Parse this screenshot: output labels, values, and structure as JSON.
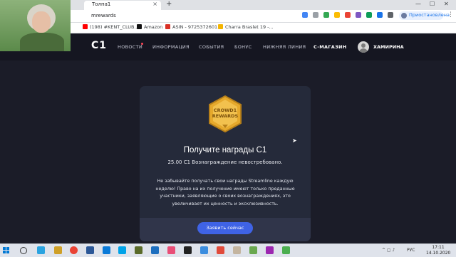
{
  "browser": {
    "tab_title": "Толпа1",
    "tab_close": "×",
    "new_tab": "+",
    "url": "mrewards",
    "profile_label": "Приостановлена",
    "window_controls": [
      "—",
      "☐",
      "✕"
    ],
    "bookmarks": [
      {
        "label": "(198) #KENT_CLUB...",
        "icon": "youtube-icon",
        "color": "#ff0000"
      },
      {
        "label": "Amazon",
        "icon": "amazon-icon",
        "color": "#111111"
      },
      {
        "label": "ASIN - 9725372601...",
        "icon": "gmail-icon",
        "color": "#d93025"
      },
      {
        "label": "Charra Braslet 19 -...",
        "icon": "drive-icon",
        "color": "#f4b400"
      }
    ]
  },
  "site": {
    "logo": "C1",
    "nav": [
      {
        "label": "НОВОСТИ",
        "has_dot": true,
        "active": false
      },
      {
        "label": "ИНФОРМАЦИЯ",
        "active": false
      },
      {
        "label": "СОБЫТИЯ",
        "active": false
      },
      {
        "label": "БОНУС",
        "active": false
      },
      {
        "label": "НИЖНЯЯ ЛИНИЯ",
        "active": false
      },
      {
        "label": "C-МАГАЗИН",
        "active": true
      }
    ],
    "username": "ХАМИРИНА",
    "colors": {
      "accent": "#3f63e6",
      "badge_gold": "#e6a92c",
      "background": "#1b1c28",
      "card": "#252a3a"
    }
  },
  "card": {
    "badge_line1": "CROWD1",
    "badge_line2": "REWARDS",
    "title": "Получите награды C1",
    "amount": "25.00 C1 Вознаграждение невостребовано.",
    "description": "Не забывайте получать свои награды Streamline каждую неделю! Право на их получение имеют только преданные участники, заявляющие о своих вознаграждениях, это увеличивает их ценность и эксклюзивность.",
    "button": "Заявить сейчас"
  },
  "taskbar": {
    "lang": "РУС",
    "time": "17:11",
    "date": "14.10.2020"
  }
}
